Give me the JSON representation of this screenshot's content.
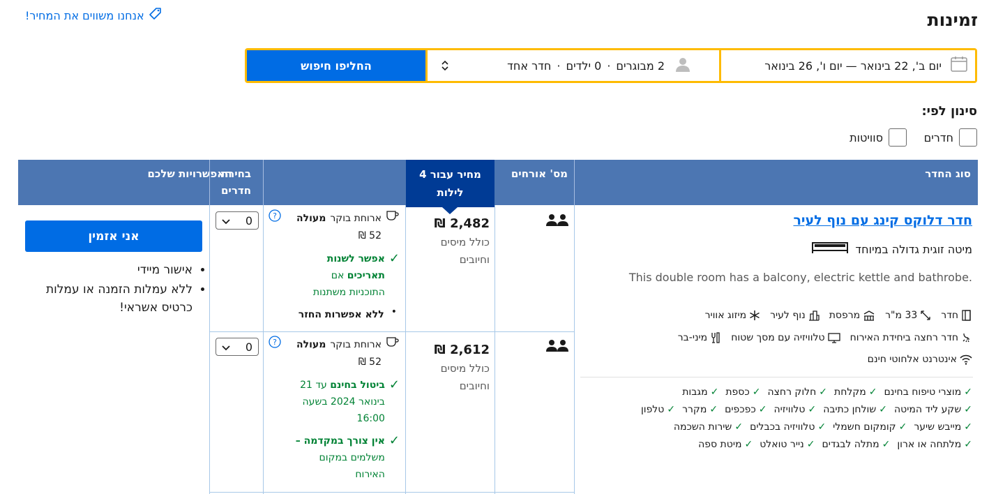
{
  "page": {
    "title": "זמינות",
    "price_match": "אנחנו משווים את המחיר!"
  },
  "search": {
    "dates": "יום ב', 22 בינואר — יום ו', 26 בינואר",
    "adults": "2 מבוגרים",
    "children": "0 ילדים",
    "rooms": "חדר אחד",
    "dot": "·",
    "button": "החליפו חיפוש"
  },
  "filter": {
    "title": "סינון לפי:",
    "options": [
      "חדרים",
      "סוויטות"
    ]
  },
  "table": {
    "headers": {
      "room_type": "סוג החדר",
      "guests": "מס' אורחים",
      "price_line1": "מחיר עבור 4",
      "price_line2": "לילות",
      "options": "האפשרויות שלכם",
      "select_line1": "בחירת",
      "select_line2": "חדרים"
    }
  },
  "room": {
    "name": "חדר דלוקס קינג עם נוף לעיר",
    "bed": "מיטה זוגית גדולה במיוחד",
    "description": "This double room has a balcony, electric kettle and bathrobe.",
    "features": [
      {
        "icon": "room-icon",
        "label": "חדר"
      },
      {
        "icon": "size-icon",
        "label": "33 מ\"ר"
      },
      {
        "icon": "balcony-icon",
        "label": "מרפסת"
      },
      {
        "icon": "city-view-icon",
        "label": "נוף לעיר"
      },
      {
        "icon": "snowflake-icon",
        "label": "מיזוג אוויר"
      },
      {
        "icon": "bath-icon",
        "label": "חדר רחצה ביחידת האירוח"
      },
      {
        "icon": "tv-icon",
        "label": "טלוויזיה עם מסך שטוח"
      },
      {
        "icon": "minibar-icon",
        "label": "מיני-בר"
      },
      {
        "icon": "wifi-icon",
        "label": "אינטרנט אלחוטי חינם"
      }
    ],
    "amenities": [
      [
        "מוצרי טיפוח בחינם",
        "מקלחת",
        "חלוק רחצה",
        "כספת",
        "מגבות"
      ],
      [
        "שקע ליד המיטה",
        "שולחן כתיבה",
        "טלוויזיה",
        "כפכפים",
        "מקרר",
        "טלפון"
      ],
      [
        "מייבש שיער",
        "קומקום חשמלי",
        "טלוויזיה בכבלים",
        "שירות השכמה"
      ],
      [
        "מלתחה או ארון",
        "מתלה לבגדים",
        "נייר טואלט",
        "מיטת ספה"
      ]
    ]
  },
  "offers": [
    {
      "price": "2,482 ₪",
      "tax_line1": "כולל מיסים",
      "tax_line2": "וחיובים",
      "breakfast_label": "ארוחת בוקר",
      "breakfast_quality": "מעולה",
      "breakfast_price": "52 ₪",
      "flex_bold1": "אפשר לשנות",
      "flex_bold2": "תאריכים",
      "flex_rest1": "אם",
      "flex_rest2": "התוכניות משתנות",
      "no_option": "ללא אפשרות החזר",
      "qty": "0"
    },
    {
      "price": "2,612 ₪",
      "tax_line1": "כולל מיסים",
      "tax_line2": "וחיובים",
      "breakfast_label": "ארוחת בוקר",
      "breakfast_quality": "מעולה",
      "breakfast_price": "52 ₪",
      "cancel_bold": "ביטול בחינם",
      "cancel_rest1": "עד 21",
      "cancel_rest2": "בינואר 2024 בשעה",
      "cancel_rest3": "16:00",
      "prepay_bold": "אין צורך במקדמה –",
      "prepay_rest1": "משלמים במקום",
      "prepay_rest2": "האירוח",
      "qty": "0"
    }
  ],
  "reserve": {
    "button": "אני אזמין",
    "bullets": [
      "אישור מיידי",
      "ללא עמלות הזמנה או עמלות",
      "כרטיס אשראי!"
    ]
  },
  "colors": {
    "accent": "#006ce4",
    "header": "#4c76b2",
    "header_dark": "#003b95",
    "search_border": "#febb02",
    "green": "#008234"
  }
}
